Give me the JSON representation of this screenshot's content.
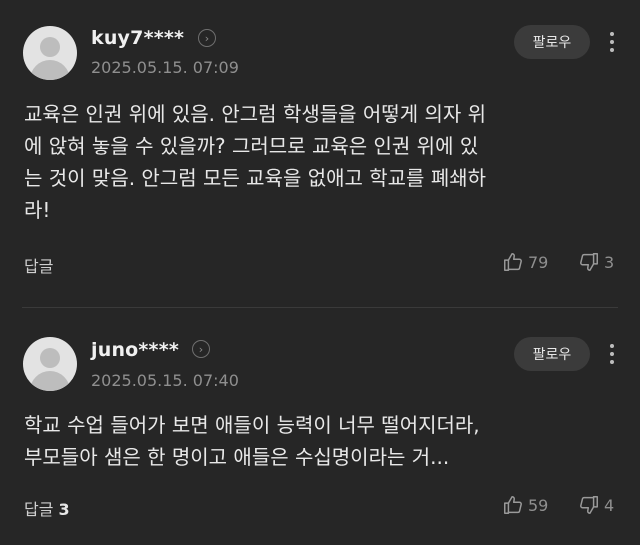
{
  "comments": [
    {
      "username": "kuy7****",
      "date": "2025.05.15. 07:09",
      "follow_label": "팔로우",
      "lines": [
        "교육은 인권 위에 있음. 안그럼 학생들을 어떻게 의자 위",
        "에 앉혀 놓을 수 있을까? 그러므로 교육은 인권 위에 있",
        "는 것이 맞음. 안그럼 모든 교육을 없애고 학교를 폐쇄하",
        "라!"
      ],
      "reply_label": "답글",
      "reply_count": "",
      "likes": "79",
      "dislikes": "3"
    },
    {
      "username": "juno****",
      "date": "2025.05.15. 07:40",
      "follow_label": "팔로우",
      "lines": [
        "학교 수업 들어가 보면 애들이 능력이 너무 떨어지더라,",
        "부모들아 샘은 한 명이고 애들은 수십명이라는 거..."
      ],
      "reply_label": "답글",
      "reply_count": "3",
      "likes": "59",
      "dislikes": "4"
    }
  ],
  "icons": {
    "avatar": "default-user-avatar",
    "profile_link": "chevron-right-circle-icon",
    "more": "more-vertical-icon",
    "like": "thumbs-up-icon",
    "dislike": "thumbs-down-icon"
  }
}
